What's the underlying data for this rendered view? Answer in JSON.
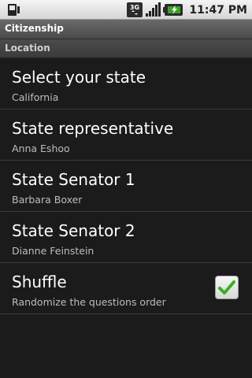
{
  "status_bar": {
    "time": "11:47 PM",
    "network_label": "3G",
    "icons": [
      "sim-card-icon",
      "3g-data-icon",
      "signal-strength-icon",
      "battery-charging-icon"
    ]
  },
  "app": {
    "title": "Citizenship"
  },
  "category": {
    "label": "Location"
  },
  "preferences": [
    {
      "title": "Select your state",
      "summary": "California"
    },
    {
      "title": "State representative",
      "summary": "Anna Eshoo"
    },
    {
      "title": "State Senator 1",
      "summary": "Barbara Boxer"
    },
    {
      "title": "State Senator 2",
      "summary": "Dianne Feinstein"
    },
    {
      "title": "Shuffle",
      "summary": "Randomize the questions order",
      "checked": true
    }
  ],
  "colors": {
    "check_green": "#35b21e",
    "background": "#1b1b1b"
  }
}
